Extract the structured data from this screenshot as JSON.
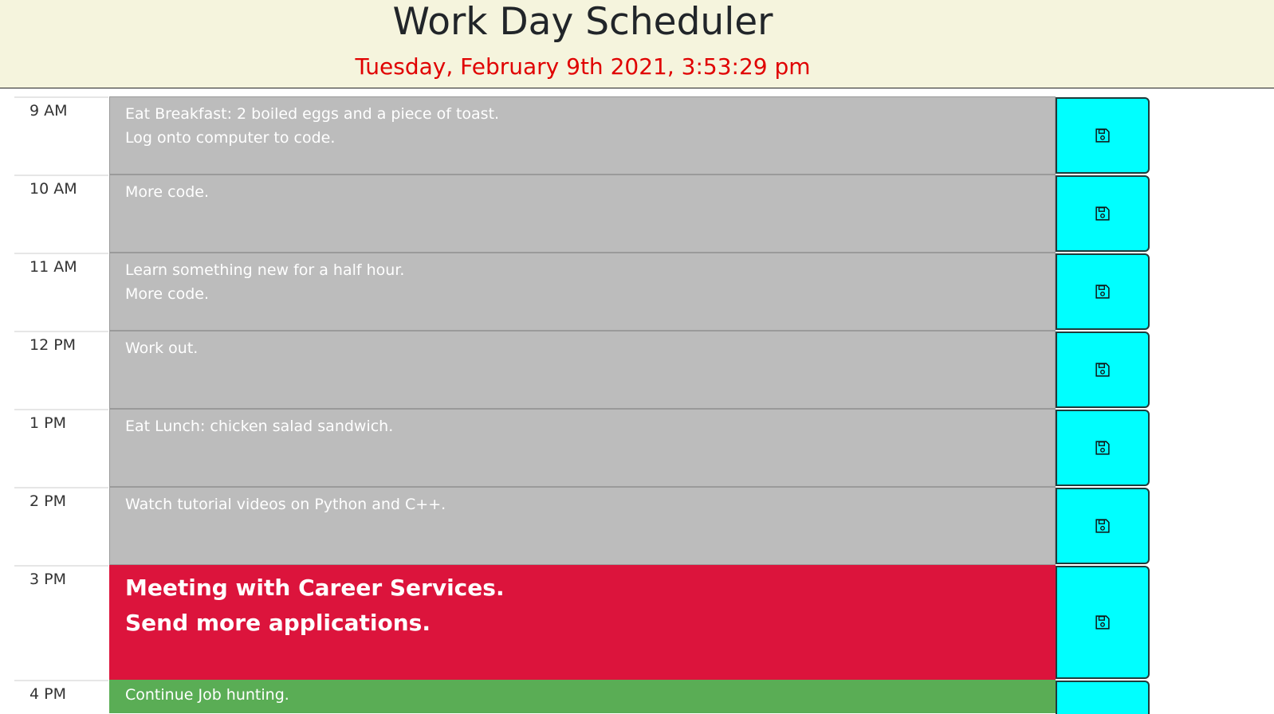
{
  "header": {
    "title": "Work Day Scheduler",
    "date": "Tuesday, February 9th 2021, 3:53:29 pm"
  },
  "colors": {
    "header_bg": "#f5f4dd",
    "date_text": "#e00000",
    "past": "#bcbcbc",
    "present": "#dc143c",
    "future": "#5aad55",
    "save_button": "#00ffff"
  },
  "rows": [
    {
      "hour": "9 AM",
      "text": "Eat Breakfast: 2 boiled eggs and a piece of toast.\nLog onto computer to code.",
      "state": "past",
      "save_icon": "save-icon"
    },
    {
      "hour": "10 AM",
      "text": "More code.",
      "state": "past",
      "save_icon": "save-icon"
    },
    {
      "hour": "11 AM",
      "text": "Learn something new for a half hour.\nMore code.",
      "state": "past",
      "save_icon": "save-icon"
    },
    {
      "hour": "12 PM",
      "text": "Work out.",
      "state": "past",
      "save_icon": "save-icon"
    },
    {
      "hour": "1 PM",
      "text": "Eat Lunch: chicken salad sandwich.",
      "state": "past",
      "save_icon": "save-icon"
    },
    {
      "hour": "2 PM",
      "text": "Watch tutorial videos on Python and C++.",
      "state": "past",
      "save_icon": "save-icon"
    },
    {
      "hour": "3 PM",
      "text": "Meeting with Career Services.\nSend more applications.",
      "state": "present",
      "save_icon": "save-icon"
    },
    {
      "hour": "4 PM",
      "text": "Continue Job hunting.",
      "state": "future",
      "save_icon": "save-icon"
    }
  ]
}
